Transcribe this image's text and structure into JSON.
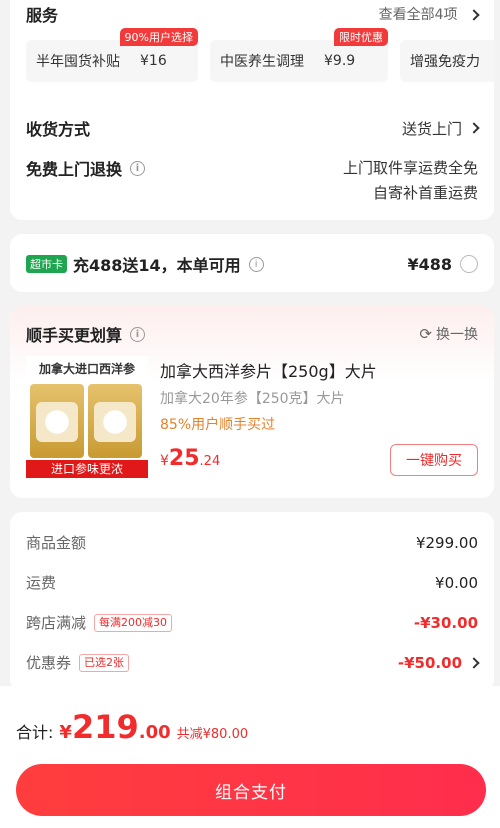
{
  "services": {
    "section_title": "服务",
    "view_all": "查看全部4项",
    "items": [
      {
        "name": "半年囤货补贴",
        "price": "¥16",
        "badge": "90%用户选择"
      },
      {
        "name": "中医养生调理",
        "price": "¥9.9",
        "badge": "限时优惠"
      },
      {
        "name": "增强免疫力",
        "price": "",
        "badge": ""
      }
    ]
  },
  "delivery": {
    "label": "收货方式",
    "value": "送货上门"
  },
  "returns": {
    "label": "免费上门退换",
    "line1": "上门取件享运费全免",
    "line2": "自寄补首重运费"
  },
  "supermarket": {
    "badge": "超市卡",
    "text": "充488送14，本单可用",
    "price": "¥488"
  },
  "bundle": {
    "title": "顺手买更划算",
    "refresh": "换一换",
    "product_image_caption": "加拿大进口西洋参",
    "product_image_banner": "进口参味更浓",
    "product_name": "加拿大西洋参片【250g】大片",
    "product_subtitle": "加拿大20年参【250克】大片",
    "product_stat": "85%用户顺手买过",
    "price_symbol": "¥",
    "price_int": "25",
    "price_dec": ".24",
    "buy_button": "一键购买"
  },
  "summary": {
    "rows": [
      {
        "label": "商品金额",
        "value": "¥299.00"
      },
      {
        "label": "运费",
        "value": "¥0.00"
      },
      {
        "label": "跨店满减",
        "tag": "每满200减30",
        "value": "-¥30.00"
      },
      {
        "label": "优惠券",
        "tag": "已选2张",
        "value": "-¥50.00"
      }
    ]
  },
  "footer": {
    "total_label": "合计:",
    "total_symbol": "¥",
    "total_int": "219",
    "total_dec": ".00",
    "saved": "共减¥80.00",
    "pay_button": "组合支付"
  },
  "colors": {
    "accent": "#f02c2c",
    "card_badge": "#1ea54f"
  }
}
